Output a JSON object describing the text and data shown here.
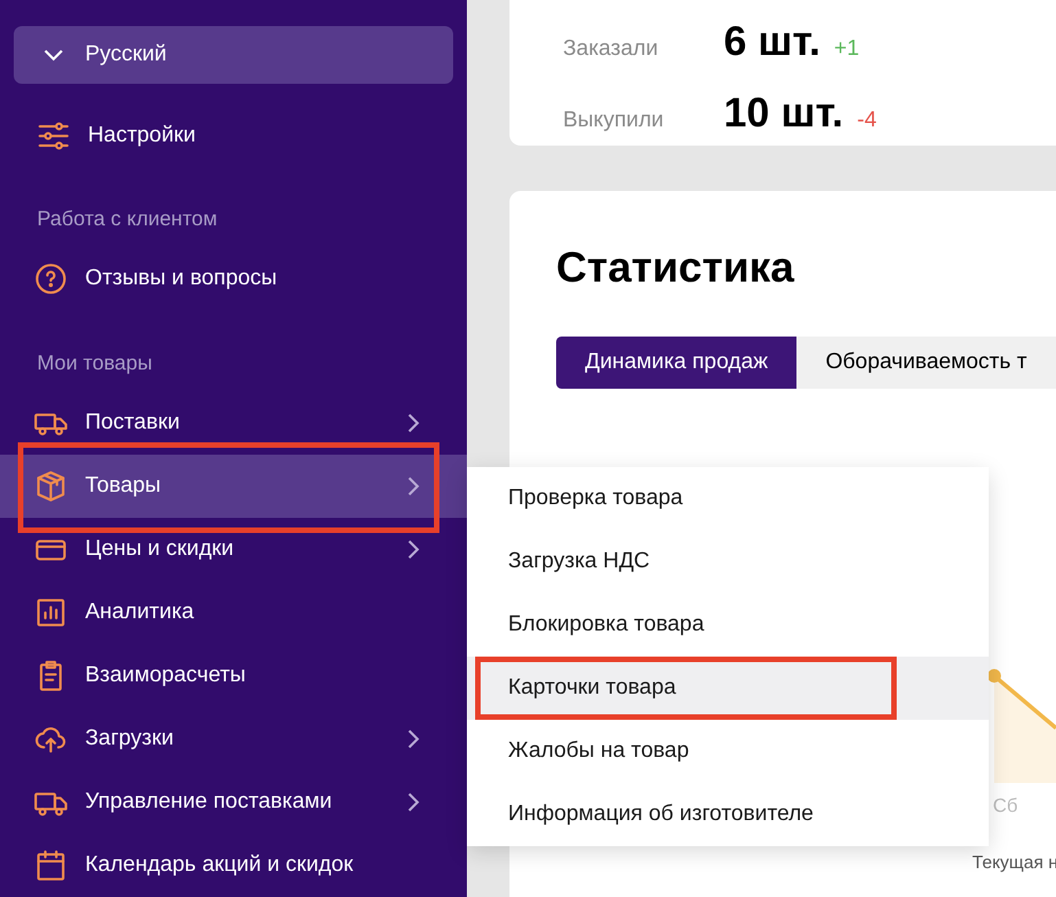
{
  "sidebar": {
    "language": {
      "label": "Русский"
    },
    "settings": {
      "label": "Настройки"
    },
    "sections": [
      {
        "title": "Работа с клиентом",
        "items": [
          {
            "label": "Отзывы и вопросы",
            "has_submenu": false,
            "selected": false,
            "annotated": false
          }
        ]
      },
      {
        "title": "Мои товары",
        "items": [
          {
            "label": "Поставки",
            "has_submenu": true,
            "selected": false,
            "annotated": false
          },
          {
            "label": "Товары",
            "has_submenu": true,
            "selected": true,
            "annotated": true
          },
          {
            "label": "Цены и скидки",
            "has_submenu": true,
            "selected": false,
            "annotated": false
          },
          {
            "label": "Аналитика",
            "has_submenu": false,
            "selected": false,
            "annotated": false
          },
          {
            "label": "Взаиморасчеты",
            "has_submenu": false,
            "selected": false,
            "annotated": false
          },
          {
            "label": "Загрузки",
            "has_submenu": true,
            "selected": false,
            "annotated": false
          },
          {
            "label": "Управление поставками",
            "has_submenu": true,
            "selected": false,
            "annotated": false
          },
          {
            "label": "Календарь акций и скидок",
            "has_submenu": false,
            "selected": false,
            "annotated": false
          }
        ]
      }
    ]
  },
  "stats": [
    {
      "label": "Заказали",
      "value": "6 шт.",
      "delta": "+1",
      "positive": true
    },
    {
      "label": "Выкупили",
      "value": "10 шт.",
      "delta": "-4",
      "positive": false
    }
  ],
  "statistics": {
    "title": "Статистика",
    "tabs": [
      {
        "label": "Динамика продаж",
        "selected": true
      },
      {
        "label": "Оборачиваемость т",
        "selected": false
      }
    ],
    "axis_label": "Сб",
    "legend": [
      "Текущая н"
    ]
  },
  "submenu": {
    "items": [
      {
        "label": "Проверка товара",
        "hovered": false,
        "annotated": false
      },
      {
        "label": "Загрузка НДС",
        "hovered": false,
        "annotated": false
      },
      {
        "label": "Блокировка товара",
        "hovered": false,
        "annotated": false
      },
      {
        "label": "Карточки товара",
        "hovered": true,
        "annotated": true
      },
      {
        "label": "Жалобы на товар",
        "hovered": false,
        "annotated": false
      },
      {
        "label": "Информация об изготовителе",
        "hovered": false,
        "annotated": false
      }
    ]
  }
}
